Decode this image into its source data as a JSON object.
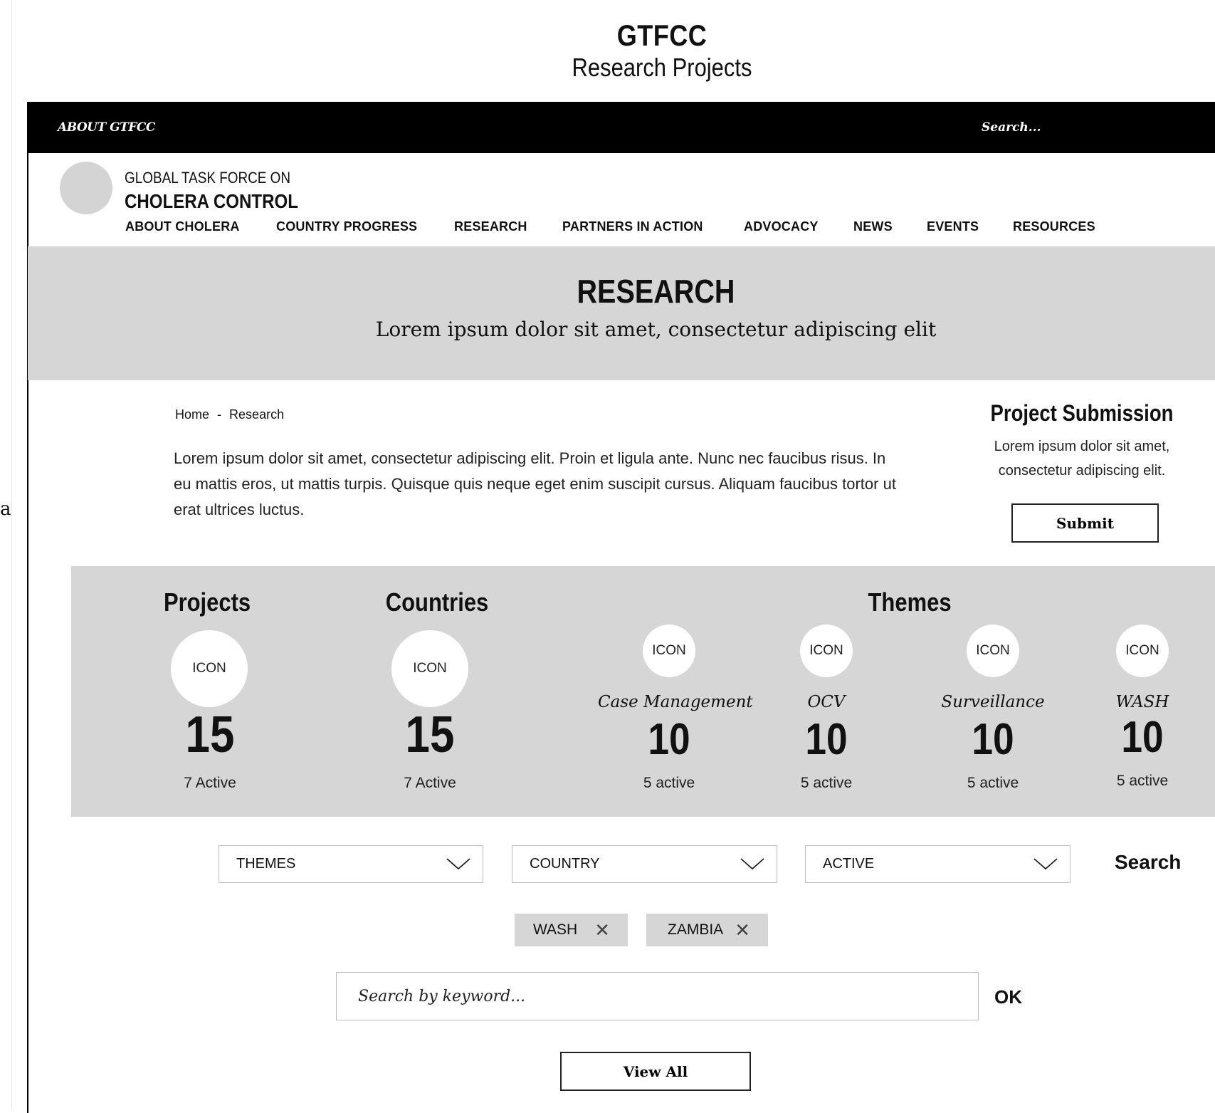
{
  "doc": {
    "title": "GTFCC",
    "subtitle": "Research Projects"
  },
  "stray": "a",
  "topbar": {
    "about": "ABOUT GTFCC",
    "search": "Search..."
  },
  "org": {
    "line1": "GLOBAL TASK FORCE ON",
    "line2": "CHOLERA CONTROL"
  },
  "nav": [
    "ABOUT CHOLERA",
    "COUNTRY PROGRESS",
    "RESEARCH",
    "PARTNERS IN ACTION",
    "ADVOCACY",
    "NEWS",
    "EVENTS",
    "RESOURCES"
  ],
  "hero": {
    "title": "RESEARCH",
    "subtitle": "Lorem ipsum dolor sit amet, consectetur adipiscing elit"
  },
  "breadcrumb": {
    "home": "Home",
    "sep": "-",
    "current": "Research"
  },
  "intro": "Lorem ipsum dolor sit amet, consectetur adipiscing elit. Proin et ligula ante. Nunc nec faucibus risus. In eu mattis eros, ut mattis turpis. Quisque quis neque eget enim suscipit cursus. Aliquam faucibus tortor ut erat ultrices luctus.",
  "submission": {
    "title": "Project Submission",
    "text": "Lorem ipsum dolor sit amet, consectetur adipiscing elit.",
    "button": "Submit"
  },
  "stats": {
    "projects": {
      "heading": "Projects",
      "icon": "ICON",
      "value": "15",
      "active": "7 Active"
    },
    "countries": {
      "heading": "Countries",
      "icon": "ICON",
      "value": "15",
      "active": "7 Active"
    },
    "themes_heading": "Themes",
    "themes": [
      {
        "icon": "ICON",
        "name": "Case Management",
        "value": "10",
        "active": "5 active"
      },
      {
        "icon": "ICON",
        "name": "OCV",
        "value": "10",
        "active": "5 active"
      },
      {
        "icon": "ICON",
        "name": "Surveillance",
        "value": "10",
        "active": "5 active"
      },
      {
        "icon": "ICON",
        "name": "WASH",
        "value": "10",
        "active": "5 active"
      }
    ]
  },
  "filters": {
    "themes": "THEMES",
    "country": "COUNTRY",
    "active": "ACTIVE",
    "search": "Search"
  },
  "chips": [
    {
      "label": "WASH",
      "remove": "✕"
    },
    {
      "label": "ZAMBIA",
      "remove": "✕"
    }
  ],
  "keyword": {
    "placeholder": "Search by keyword...",
    "ok": "OK"
  },
  "view_all": "View All"
}
